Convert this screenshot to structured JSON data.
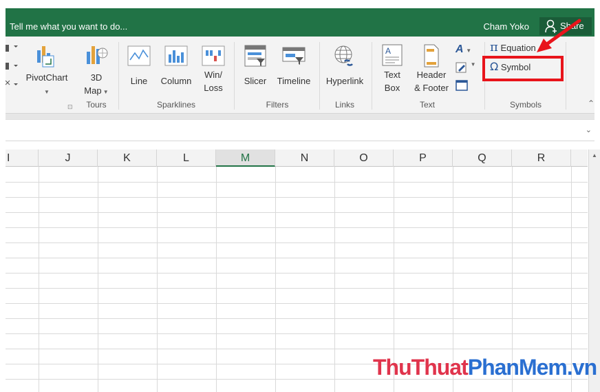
{
  "topbar": {
    "tell_me": "Tell me what you want to do...",
    "user": "Cham Yoko",
    "share": "Share"
  },
  "ribbon": {
    "pivotchart": "PivotChart",
    "map3d_line1": "3D",
    "map3d_line2": "Map",
    "line": "Line",
    "column": "Column",
    "winloss_line1": "Win/",
    "winloss_line2": "Loss",
    "slicer": "Slicer",
    "timeline": "Timeline",
    "hyperlink": "Hyperlink",
    "textbox_line1": "Text",
    "textbox_line2": "Box",
    "header_line1": "Header",
    "header_line2": "& Footer",
    "equation": "Equation",
    "symbol": "Symbol",
    "groups": {
      "tours": "Tours",
      "sparklines": "Sparklines",
      "filters": "Filters",
      "links": "Links",
      "text": "Text",
      "symbols": "Symbols"
    }
  },
  "sheet": {
    "columns": [
      "I",
      "J",
      "K",
      "L",
      "M",
      "N",
      "O",
      "P",
      "Q",
      "R"
    ],
    "selected_column": "M"
  },
  "watermark": {
    "part1": "ThuThuat",
    "part2": "PhanMem",
    "part3": ".vn"
  },
  "colors": {
    "excel_green": "#217346",
    "highlight_red": "#e8141b"
  }
}
